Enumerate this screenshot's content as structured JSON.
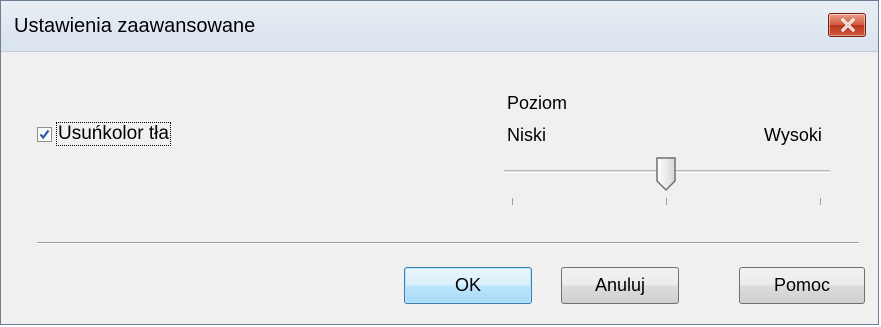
{
  "window": {
    "title": "Ustawienia zaawansowane",
    "close_icon": "close-x-icon"
  },
  "checkbox": {
    "label": "Usuńkolor tła",
    "checked": true
  },
  "slider": {
    "title": "Poziom",
    "low_label": "Niski",
    "high_label": "Wysoki",
    "value_fraction": 0.5,
    "tick_count": 3
  },
  "buttons": {
    "ok_label": "OK",
    "cancel_label": "Anuluj",
    "help_label": "Pomoc"
  },
  "colors": {
    "close_button": "#c7462c",
    "default_button": "#3c7fb1"
  }
}
